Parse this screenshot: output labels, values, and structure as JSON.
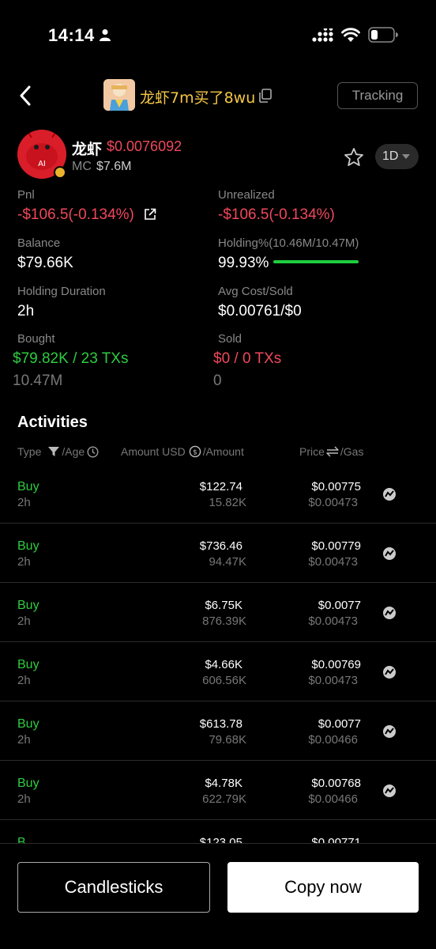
{
  "status_bar": {
    "time": "14:14"
  },
  "nav": {
    "title": "龙虾7m买了8wu",
    "tracking_label": "Tracking"
  },
  "token": {
    "avatar_text": "AI",
    "name": "龙虾",
    "price": "$0.0076092",
    "mc_label": "MC",
    "mc_value": "$7.6M",
    "timeframe": "1D"
  },
  "stats": {
    "pnl_label": "Pnl",
    "pnl_value": "-$106.5(-0.134%)",
    "unrealized_label": "Unrealized",
    "unrealized_value": "-$106.5(-0.134%)",
    "balance_label": "Balance",
    "balance_value": "$79.66K",
    "holding_label": "Holding%(10.46M/10.47M)",
    "holding_value": "99.93%",
    "holding_fraction": 0.9993,
    "duration_label": "Holding Duration",
    "duration_value": "2h",
    "avgcost_label": "Avg Cost/Sold",
    "avgcost_value": "$0.00761/$0",
    "bought_label": "Bought",
    "bought_value": "$79.82K / 23 TXs",
    "bought_amount": "10.47M",
    "sold_label": "Sold",
    "sold_value": "$0 / 0 TXs",
    "sold_amount": "0"
  },
  "activities": {
    "title": "Activities",
    "col_type": "Type",
    "col_age": "/Age",
    "col_usd": "Amount USD",
    "col_amount": "/Amount",
    "col_price": "Price",
    "col_gas": "/Gas",
    "rows": [
      {
        "type": "Buy",
        "age": "2h",
        "usd": "$122.74",
        "amount": "15.82K",
        "price": "$0.00775",
        "gas": "$0.00473"
      },
      {
        "type": "Buy",
        "age": "2h",
        "usd": "$736.46",
        "amount": "94.47K",
        "price": "$0.00779",
        "gas": "$0.00473"
      },
      {
        "type": "Buy",
        "age": "2h",
        "usd": "$6.75K",
        "amount": "876.39K",
        "price": "$0.0077",
        "gas": "$0.00473"
      },
      {
        "type": "Buy",
        "age": "2h",
        "usd": "$4.66K",
        "amount": "606.56K",
        "price": "$0.00769",
        "gas": "$0.00473"
      },
      {
        "type": "Buy",
        "age": "2h",
        "usd": "$613.78",
        "amount": "79.68K",
        "price": "$0.0077",
        "gas": "$0.00466"
      },
      {
        "type": "Buy",
        "age": "2h",
        "usd": "$4.78K",
        "amount": "622.79K",
        "price": "$0.00768",
        "gas": "$0.00466"
      }
    ],
    "partial_row": {
      "type": "B",
      "usd": "$123.05",
      "price": "$0.00771"
    }
  },
  "buttons": {
    "candlesticks": "Candlesticks",
    "copy_now": "Copy now"
  },
  "colors": {
    "red": "#f0485b",
    "green": "#2ecc40",
    "gold": "#f5c645",
    "background": "#000000"
  }
}
